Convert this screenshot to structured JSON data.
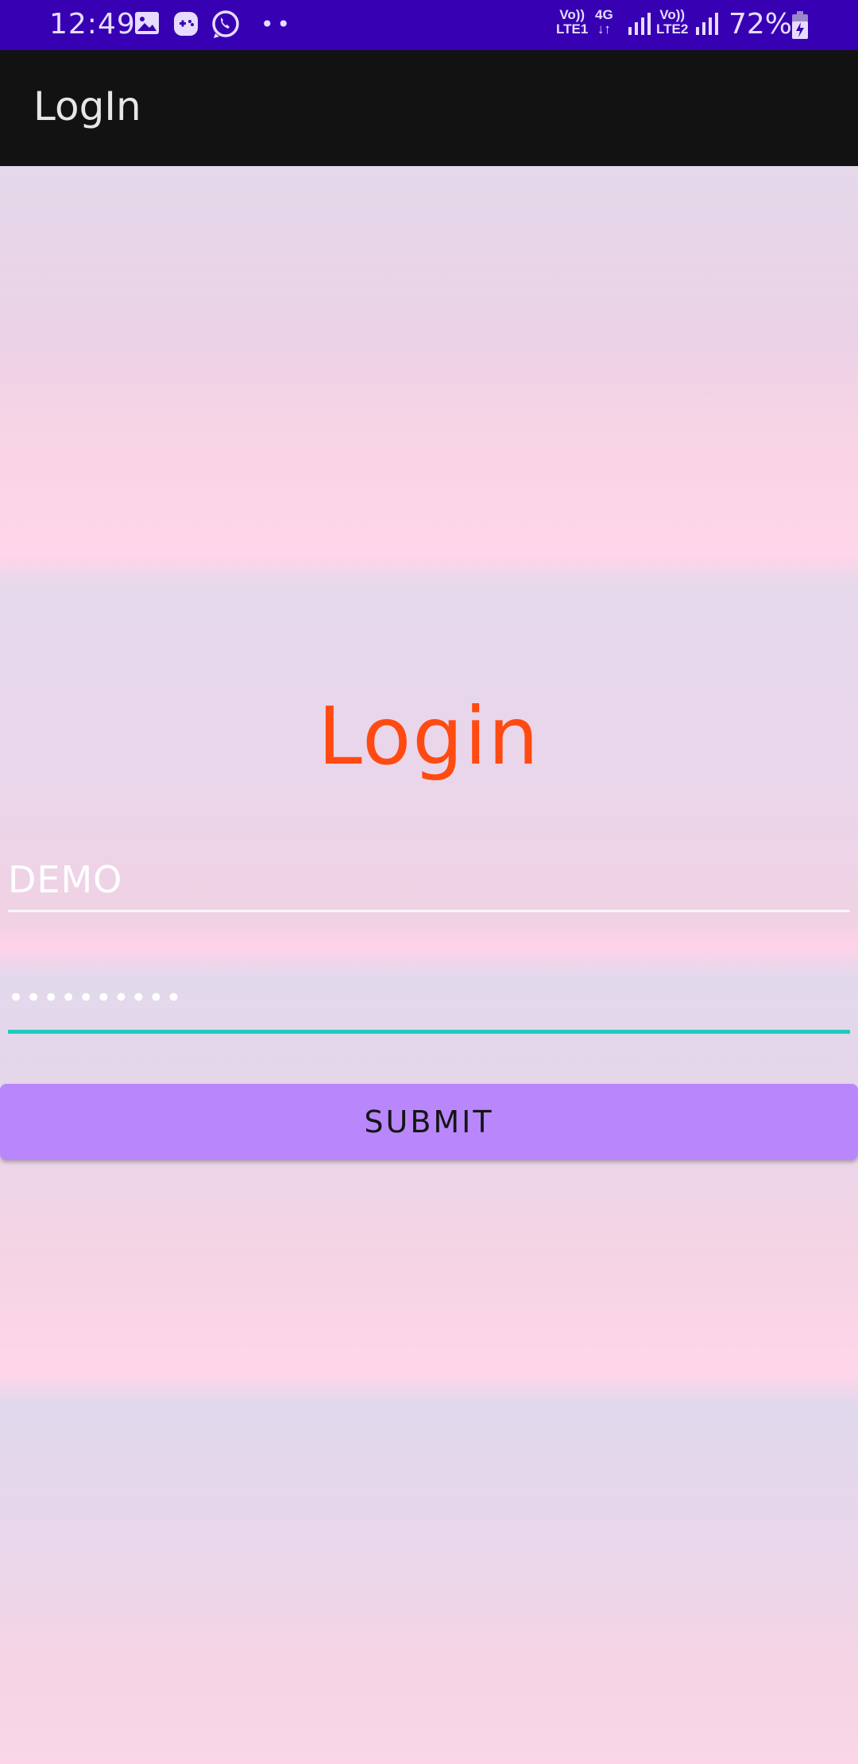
{
  "status_bar": {
    "time": "12:49",
    "network1": {
      "top": "Vo))",
      "bottom": "LTE1"
    },
    "network_type": {
      "top": "4G",
      "bottom": "↓↑"
    },
    "network2": {
      "top": "Vo))",
      "bottom": "LTE2"
    },
    "battery": "72%",
    "dots": "••",
    "icons": [
      "gallery-icon",
      "game-icon",
      "whatsapp-icon",
      "signal-icon",
      "battery-charging-icon"
    ]
  },
  "app_bar": {
    "title": "LogIn"
  },
  "login": {
    "heading": "Login",
    "username_value": "DEMO",
    "password_value": "••••••••••",
    "submit_label": "SUBMIT"
  },
  "colors": {
    "status_bar": "#3700b3",
    "app_bar": "#121212",
    "heading": "#ff4a12",
    "focused_underline": "#1ecbbf",
    "button": "#b987fb"
  }
}
